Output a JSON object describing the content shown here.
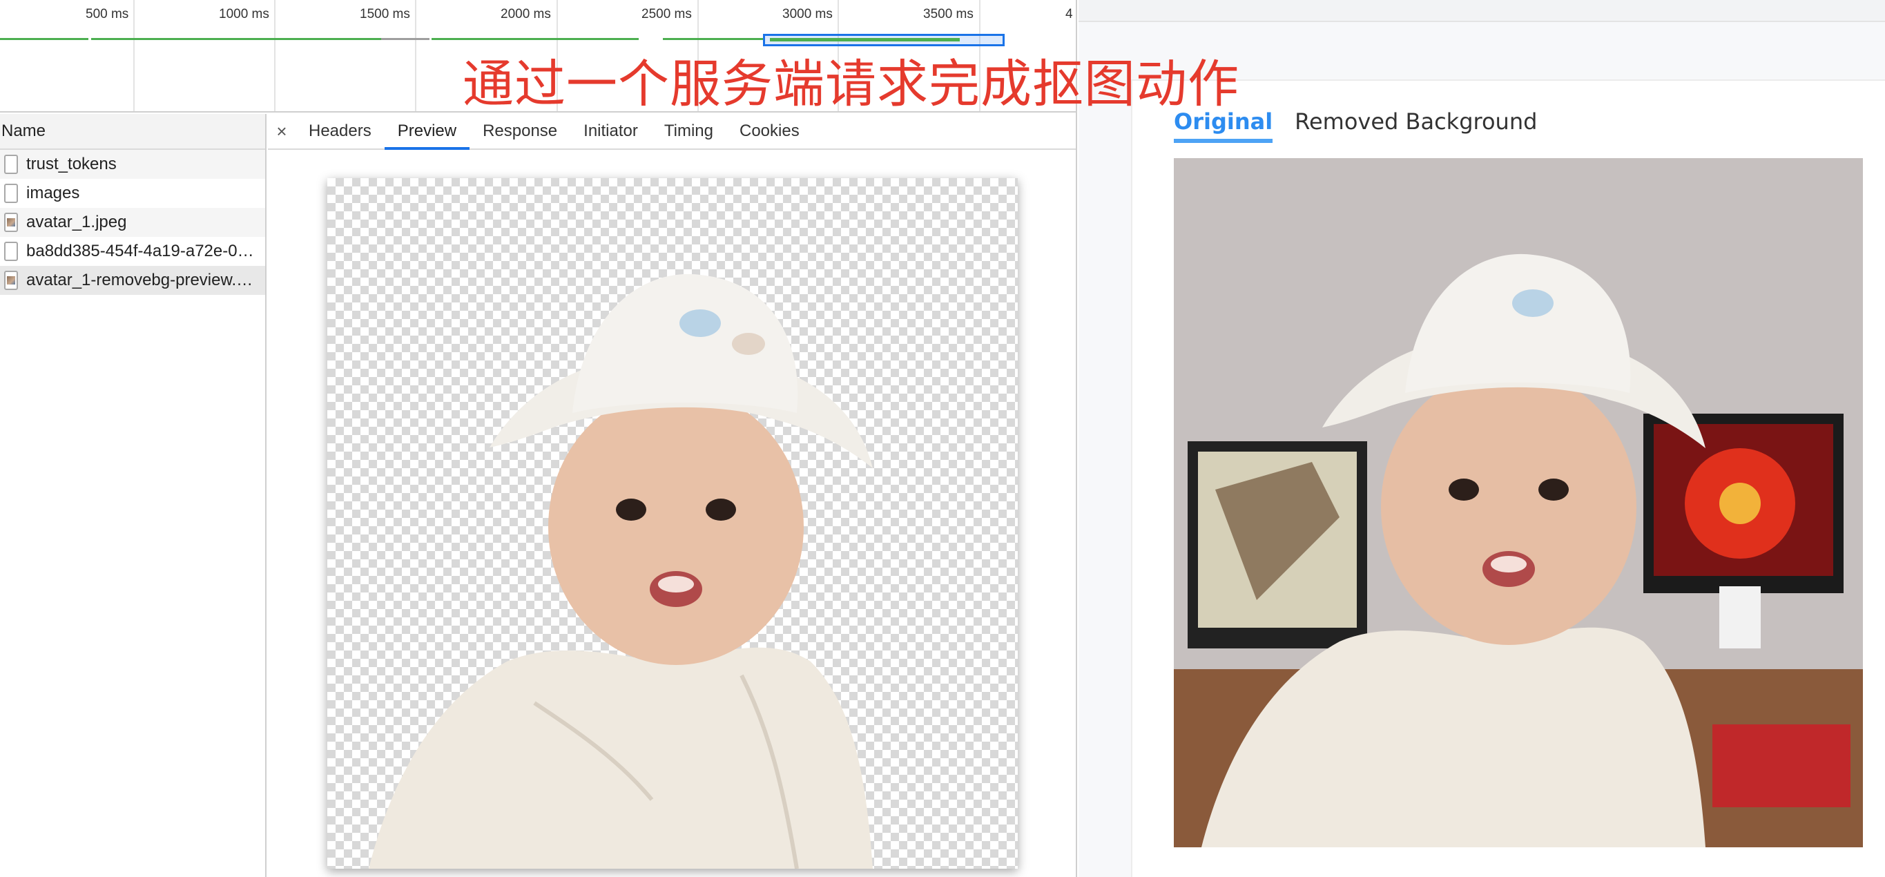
{
  "timeline": {
    "ticks": [
      "500 ms",
      "1000 ms",
      "1500 ms",
      "2000 ms",
      "2500 ms",
      "3000 ms",
      "3500 ms",
      "4"
    ]
  },
  "request_list": {
    "header": "Name",
    "items": [
      {
        "name": "trust_tokens",
        "type": "doc"
      },
      {
        "name": "images",
        "type": "doc"
      },
      {
        "name": "avatar_1.jpeg",
        "type": "img"
      },
      {
        "name": "ba8dd385-454f-4a19-a72e-0…",
        "type": "doc"
      },
      {
        "name": "avatar_1-removebg-preview.…",
        "type": "img"
      }
    ]
  },
  "detail_tabs": {
    "close": "×",
    "tabs": [
      "Headers",
      "Preview",
      "Response",
      "Initiator",
      "Timing",
      "Cookies"
    ],
    "active": "Preview"
  },
  "annotation": "通过一个服务端请求完成抠图动作",
  "webpage": {
    "tabs": [
      "Original",
      "Removed Background"
    ],
    "active_tab": "Original"
  },
  "colors": {
    "accent": "#1a73e8",
    "annotation": "#e53a2d",
    "web_tab_active": "#2d8cf0",
    "timeline_green": "#4caf50"
  }
}
